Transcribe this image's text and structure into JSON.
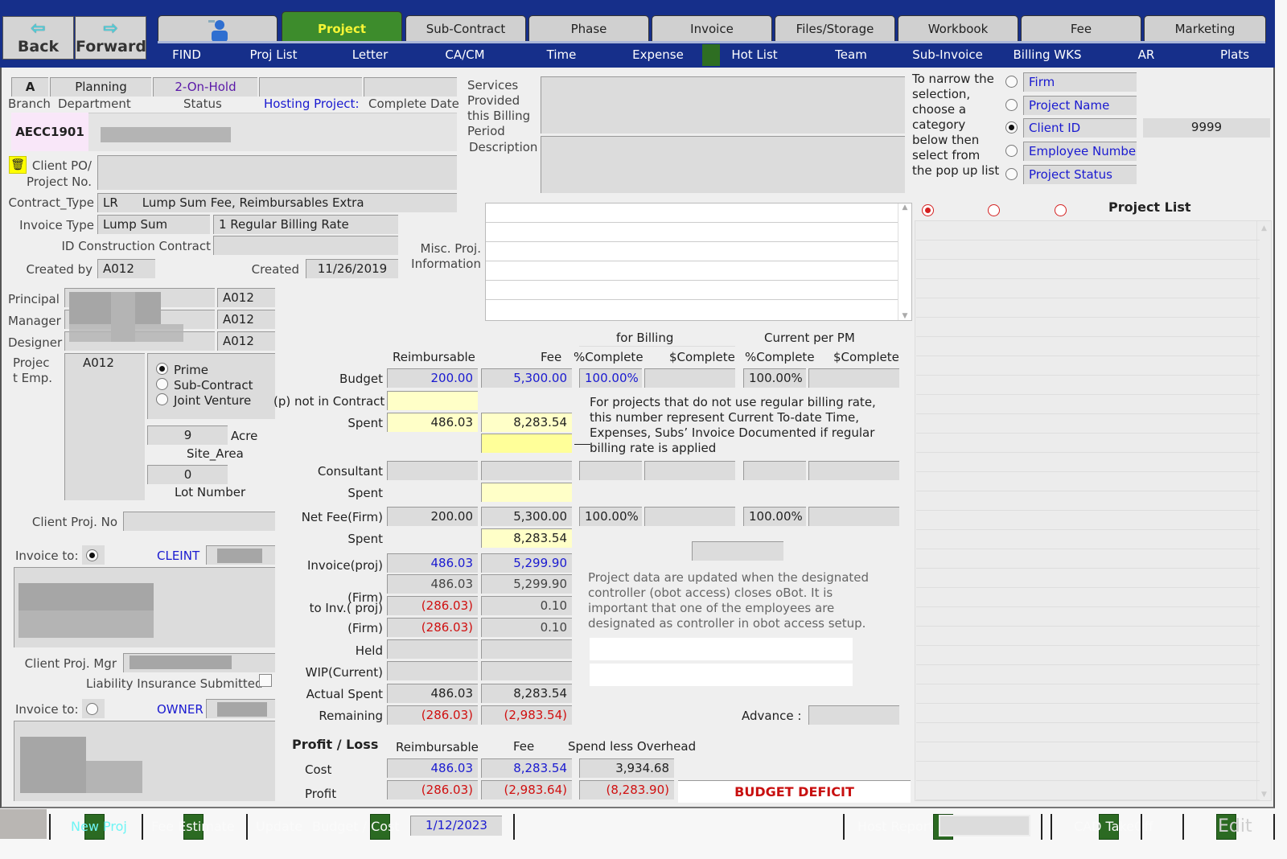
{
  "nav": {
    "back": "Back",
    "forward": "Forward",
    "back_icon": "arrow-left-icon",
    "forward_icon": "arrow-right-icon"
  },
  "tabs": [
    {
      "label": "",
      "icon": "user-icon"
    },
    {
      "label": "Project",
      "active": true
    },
    {
      "label": "Sub-Contract"
    },
    {
      "label": "Phase"
    },
    {
      "label": "Invoice"
    },
    {
      "label": "Files/Storage"
    },
    {
      "label": "Workbook"
    },
    {
      "label": "Fee"
    },
    {
      "label": "Marketing"
    }
  ],
  "subnav": [
    "FIND",
    "Proj List",
    "Letter",
    "CA/CM",
    "Time",
    "Expense",
    "Hot List",
    "Team",
    "Sub-Invoice",
    "Billing WKS",
    "AR",
    "Plats"
  ],
  "header": {
    "branch_value": "A",
    "branch_label": "Branch",
    "department_value": "Planning",
    "department_label": "Department",
    "status_value": "2-On-Hold",
    "status_label": "Status",
    "hosting_label": "Hosting Project:",
    "hosting_value": "",
    "complete_label": "Complete Date",
    "complete_value": "",
    "project_id": "AECC1901"
  },
  "project": {
    "client_po_label_1": "Client PO/",
    "client_po_label_2": "Project No.",
    "client_po_value": "",
    "contract_type_label": "Contract_Type",
    "contract_type_code": "LR",
    "contract_type_desc": "Lump Sum Fee, Reimbursables Extra",
    "invoice_type_label": "Invoice Type",
    "invoice_type_value": "Lump Sum",
    "billing_rate_value": "1 Regular Billing Rate",
    "id_construction_label": "ID Construction Contract",
    "id_construction_value": "",
    "created_by_label": "Created by",
    "created_by_value": "A012",
    "created_label": "Created",
    "created_value": "11/26/2019"
  },
  "services": {
    "label_lines": [
      "Services",
      "Provided",
      "this Billing",
      "Period"
    ],
    "description_label": "Description",
    "misc_label_1": "Misc. Proj.",
    "misc_label_2": "Information"
  },
  "filter": {
    "instruction": [
      "To narrow the",
      "selection,",
      "choose a",
      "category",
      "below then",
      "select from",
      "the pop up list"
    ],
    "options": [
      {
        "label": "Firm",
        "selected": false
      },
      {
        "label": "Project Name",
        "selected": false
      },
      {
        "label": "Client ID",
        "selected": true
      },
      {
        "label": "Employee Number",
        "selected": false
      },
      {
        "label": "Project Status",
        "selected": false
      }
    ],
    "client_id_value": "9999",
    "project_list_title": "Project List"
  },
  "team": {
    "principal_label": "Principal",
    "principal_id": "A012",
    "manager_label": "Manager",
    "manager_id": "A012",
    "designer_label": "Designer",
    "designer_id": "A012",
    "proj_emp_label_1": "Projec",
    "proj_emp_label_2": "t Emp.",
    "proj_emp_value": "A012",
    "contract_roles": [
      {
        "label": "Prime",
        "selected": true
      },
      {
        "label": "Sub-Contract",
        "selected": false
      },
      {
        "label": "Joint Venture",
        "selected": false
      }
    ],
    "site_area_value": "9",
    "site_area_unit": "Acre",
    "site_area_label": "Site_Area",
    "lot_value": "0",
    "lot_label": "Lot Number"
  },
  "client": {
    "client_proj_no_label": "Client Proj. No",
    "invoice_to_label": "Invoice to:",
    "client_label": "CLEINT",
    "client_proj_mgr_label": "Client Proj. Mgr",
    "liability_label": "Liability Insurance Submitted",
    "liability_checked": false,
    "owner_label": "OWNER",
    "invoice_to_client_selected": true,
    "invoice_to_owner_selected": false
  },
  "budget": {
    "col_reimb": "Reimbursable",
    "col_fee": "Fee",
    "for_billing": "for Billing",
    "current_pm": "Current per PM",
    "pct_complete": "%Complete",
    "dollar_complete": "$Complete",
    "rows": {
      "budget": {
        "label": "Budget",
        "reimb": "200.00",
        "fee": "5,300.00",
        "bill_pct": "100.00%",
        "bill_amt": "",
        "pm_pct": "100.00%",
        "pm_amt": ""
      },
      "not_in_contract": {
        "label": "(p) not in Contract",
        "reimb": ""
      },
      "spent": {
        "label": "Spent",
        "reimb": "486.03",
        "fee": "8,283.54"
      },
      "spent_extra": {
        "fee": ""
      },
      "consultant": {
        "label": "Consultant",
        "reimb": "",
        "fee": ""
      },
      "consultant_spent": {
        "label": "Spent",
        "fee": ""
      },
      "net_fee": {
        "label": "Net Fee(Firm)",
        "reimb": "200.00",
        "fee": "5,300.00",
        "bill_pct": "100.00%",
        "pm_pct": "100.00%"
      },
      "net_spent": {
        "label": "Spent",
        "fee": "8,283.54"
      },
      "invoice_proj": {
        "label": "Invoice(proj)",
        "reimb": "486.03",
        "fee": "5,299.90"
      },
      "invoice_firm": {
        "reimb": "486.03",
        "fee": "5,299.90"
      },
      "to_inv_proj": {
        "label_top": "(Firm)",
        "label": "to Inv.( proj)",
        "reimb": "(286.03)",
        "fee": "0.10"
      },
      "to_inv_firm": {
        "label": "(Firm)",
        "reimb": "(286.03)",
        "fee": "0.10"
      },
      "held": {
        "label": "Held",
        "reimb": "",
        "fee": ""
      },
      "wip": {
        "label": "WIP(Current)",
        "reimb": "",
        "fee": ""
      },
      "actual_spent": {
        "label": "Actual Spent",
        "reimb": "486.03",
        "fee": "8,283.54"
      },
      "remaining": {
        "label": "Remaining",
        "reimb": "(286.03)",
        "fee": "(2,983.54)"
      }
    },
    "note_billing_rate": "For projects that do not use regular billing rate, this number represent  Current To-date Time, Expenses, Subs’ Invoice Documented if regular billing rate is applied",
    "note_obot": "Project data are updated when the designated controller (obot access) closes oBot. It is important that one of the employees are designated as controller in obot access setup.",
    "advance_label": "Advance :",
    "advance_value": ""
  },
  "profit_loss": {
    "title": "Profit / Loss",
    "col_reimb": "Reimbursable",
    "col_fee": "Fee",
    "col_overhead": "Spend less Overhead",
    "cost": {
      "label": "Cost",
      "reimb": "486.03",
      "fee": "8,283.54",
      "overhead": "3,934.68"
    },
    "profit": {
      "label": "Profit",
      "reimb": "(286.03)",
      "fee": "(2,983.64)",
      "overhead": "(8,283.90)"
    },
    "status": "BUDGET DEFICIT"
  },
  "footer": {
    "new_proj": "New Proj",
    "fee_estimate": "Fee Estimate",
    "update": "Update",
    "budget_cost": "Budget / Cost",
    "date": "1/12/2023",
    "host_report": "Host Report",
    "cad_takeoff": "CAD TakeOff",
    "edit": "Edit"
  }
}
